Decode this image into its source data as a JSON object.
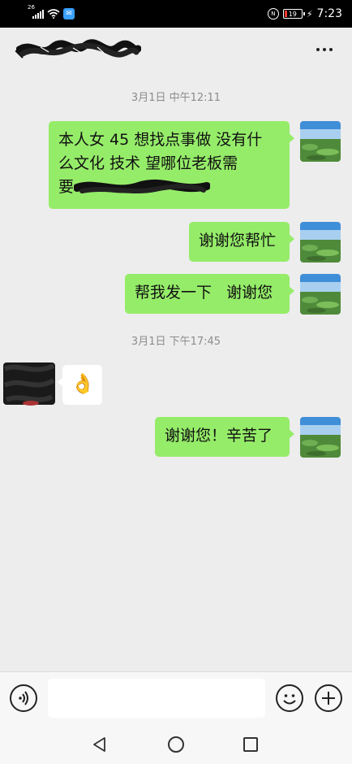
{
  "status_bar": {
    "network_tag": "26",
    "time": "7:23",
    "battery_level": "19",
    "icons": [
      "signal-icon",
      "wifi-icon",
      "app-notification-icon",
      "nfc-icon",
      "battery-icon",
      "charging-icon"
    ]
  },
  "header": {
    "back_icon": "chevron-left-icon",
    "title_redacted": true,
    "more_icon": "more-dots-icon"
  },
  "messages": [
    {
      "type": "timestamp",
      "text": "3月1日 中午12:11"
    },
    {
      "type": "outgoing",
      "line1": "本人女 45  想找点事做  没有什",
      "line2": "么文化   技术    望哪位老板需",
      "line3": "要",
      "redacted_tail": true
    },
    {
      "type": "outgoing",
      "text": "谢谢您帮忙"
    },
    {
      "type": "outgoing",
      "text": "帮我发一下   谢谢您"
    },
    {
      "type": "timestamp",
      "text": "3月1日 下午17:45"
    },
    {
      "type": "incoming",
      "sticker": "ok-hand-icon",
      "sticker_glyph": "👌"
    },
    {
      "type": "outgoing",
      "text": "谢谢您！辛苦了"
    }
  ],
  "input_bar": {
    "voice_icon": "voice-icon",
    "placeholder": "",
    "emoji_icon": "emoji-icon",
    "plus_icon": "plus-icon"
  },
  "system_nav": {
    "icons": [
      "nav-back-icon",
      "nav-home-icon",
      "nav-recent-icon"
    ]
  },
  "colors": {
    "outgoing_bubble": "#95ec69",
    "incoming_bubble": "#ffffff",
    "background": "#ededed"
  }
}
